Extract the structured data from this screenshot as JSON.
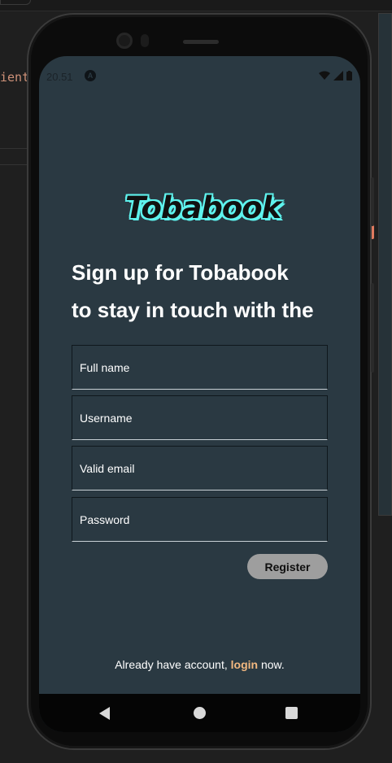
{
  "ide": {
    "code_fragment": "ient"
  },
  "status_bar": {
    "time": "20.51",
    "notification_glyph": "A"
  },
  "app": {
    "logo": "Tobabook",
    "headline_line1": "Sign up for Tobabook",
    "headline_line2": "to stay in touch with the"
  },
  "form": {
    "fullname_placeholder": "Full name",
    "username_placeholder": "Username",
    "email_placeholder": "Valid email",
    "password_placeholder": "Password",
    "register_label": "Register"
  },
  "footer": {
    "prefix": "Already have account, ",
    "login_label": "login",
    "suffix": " now."
  },
  "colors": {
    "screen_bg": "#2a3942",
    "logo_outline": "#5ef3ee",
    "login_link": "#f2b880",
    "register_bg": "#9e9e9e"
  },
  "icons": [
    "wifi-icon",
    "signal-icon",
    "battery-icon",
    "back-icon",
    "home-icon",
    "recents-icon"
  ]
}
